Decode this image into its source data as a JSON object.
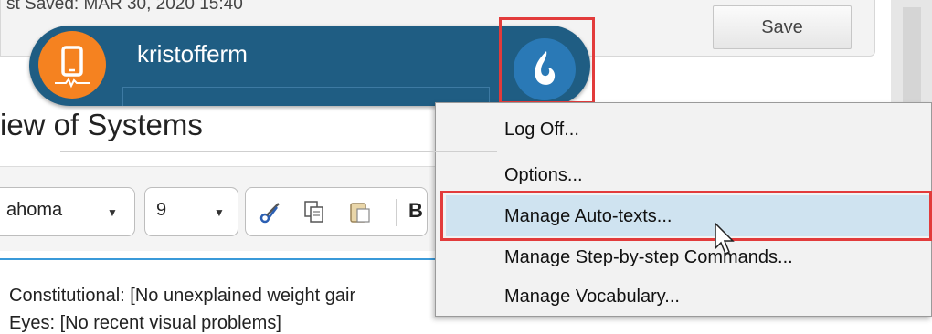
{
  "header": {
    "last_saved": "st Saved: MAR 30, 2020 15:40",
    "save_label": "Save"
  },
  "section": {
    "title": "iew of Systems"
  },
  "toolbar": {
    "font_value": "ahoma",
    "size_value": "9",
    "bold_label": "B"
  },
  "body": {
    "line1": "Constitutional: [No unexplained weight gair",
    "line2": "Eyes: [No recent visual problems]"
  },
  "dragon": {
    "username": "kristofferm",
    "brand_color": "#1f5d83",
    "device_color": "#f58220"
  },
  "menu": {
    "items": [
      "Log Off...",
      "Options...",
      "Manage Auto-texts...",
      "Manage Step-by-step Commands...",
      "Manage Vocabulary..."
    ],
    "highlighted_item": "Manage Auto-texts...",
    "highlight_color": "#e23b3b"
  },
  "icons": [
    "device-icon",
    "dragon-logo-icon",
    "scissors-icon",
    "copy-icon",
    "paste-icon",
    "cursor-icon",
    "chevron-down-icon"
  ]
}
